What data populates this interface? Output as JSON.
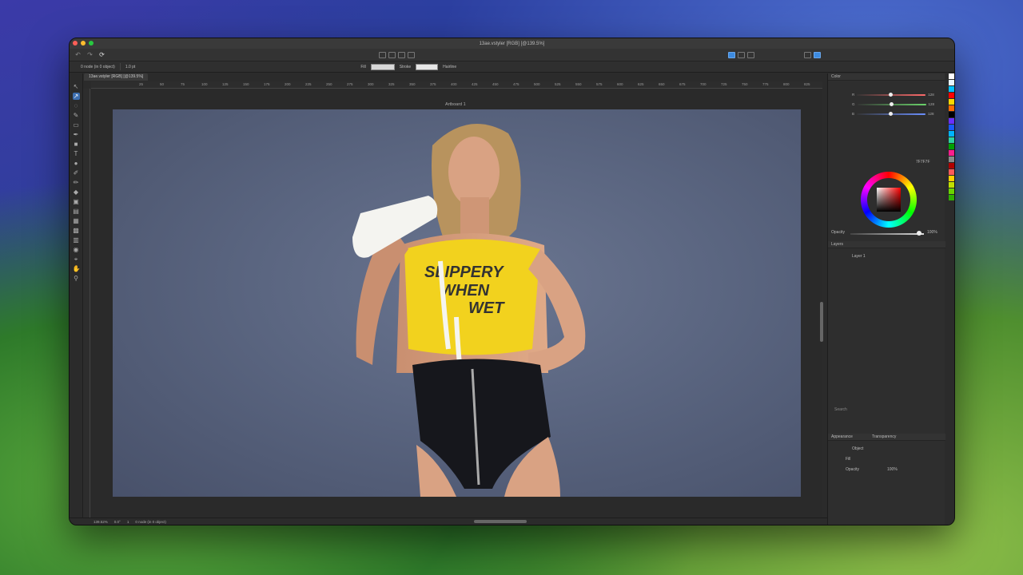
{
  "window": {
    "title": "13ae.vstyler [RGB] [@139.5%]"
  },
  "context_bar": {
    "selection": "0 node (in 0 object)",
    "line_width": "1.0 pt",
    "fill_label": "Fill",
    "stroke_label": "Stroke",
    "stroke_style": "Hairline"
  },
  "document": {
    "tab_label": "13ae.vstyler [RGB] [@139.5%]",
    "artboard_label": "Artboard 1"
  },
  "ruler": {
    "ticks": [
      "25",
      "50",
      "75",
      "100",
      "125",
      "150",
      "175",
      "200",
      "225",
      "250",
      "275",
      "300",
      "325",
      "350",
      "375",
      "400",
      "425",
      "450",
      "475",
      "500",
      "525",
      "550",
      "575",
      "600",
      "625",
      "650",
      "675",
      "700",
      "725",
      "750",
      "775",
      "800",
      "825",
      "850"
    ]
  },
  "status_bar": {
    "zoom": "139.52%",
    "angle": "0.0°",
    "page": "1",
    "selection": "0 node (in 0 object)"
  },
  "color_panel": {
    "tab": "Color",
    "channels": [
      {
        "label": "R",
        "value": "128",
        "color": "#ff6b6b"
      },
      {
        "label": "G",
        "value": "128",
        "color": "#6bd46b"
      },
      {
        "label": "B",
        "value": "128",
        "color": "#6b8fff"
      }
    ],
    "hex": "7F7F7F",
    "opacity_label": "Opacity",
    "opacity_value": "100%"
  },
  "layers_panel": {
    "tab": "Layers",
    "layers": [
      {
        "name": "Layer 1"
      }
    ],
    "search_placeholder": "Search"
  },
  "appearance_panel": {
    "tab_appearance": "Appearance",
    "tab_transparency": "Transparency",
    "object_label": "Object",
    "fill_label": "Fill",
    "opacity_label": "Opacity",
    "opacity_value": "100%"
  },
  "palette_colors": [
    "#ffffff",
    "#e8f4ff",
    "#00c0ff",
    "#ff0000",
    "#ffd800",
    "#ff6a00",
    "#000000",
    "#6a2fff",
    "#1a5aff",
    "#00b4ff",
    "#2dd2a0",
    "#00a000",
    "#ff1d8e",
    "#8a8a8a",
    "#b00000",
    "#ff5a5a",
    "#ffd000",
    "#c0e000",
    "#6ad400",
    "#30b000"
  ]
}
